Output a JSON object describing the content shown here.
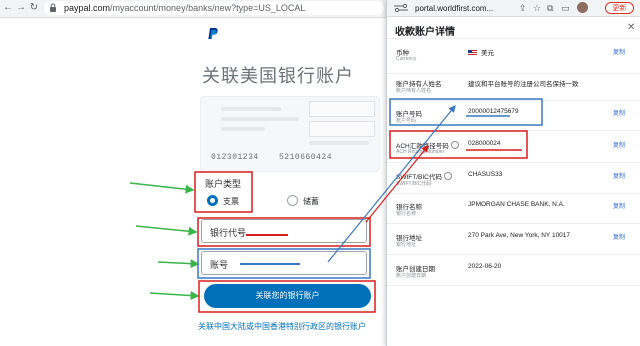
{
  "left_browser": {
    "url_host": "paypal.com",
    "url_path": "/myaccount/money/banks/new?type=US_LOCAL",
    "page_heading": "关联美国银行账户",
    "check_routing_number": "012301234",
    "check_account_number": "5210660424",
    "account_type_label": "账户类型",
    "account_type_options": [
      "支票",
      "储蓄"
    ],
    "account_type_selected": "支票",
    "routing_field_placeholder": "银行代号",
    "account_field_placeholder": "账号",
    "submit_label": "关联您的银行账户",
    "bottom_link": "关联中国大陆或中国香港特别行政区的银行账户"
  },
  "right_browser": {
    "url": "portal.worldfirst.com...",
    "update_label": "更新",
    "panel_title": "收款账户详情",
    "copy_label": "复制",
    "rows": [
      {
        "label": "币种",
        "sub": "Currency",
        "value": "美元",
        "copy": true,
        "flag": "us-flag-icon"
      },
      {
        "label": "账户持有人姓名",
        "sub": "账户持有人姓名",
        "value": "建议和平台账号的注册公司名保持一致",
        "copy": false
      },
      {
        "label": "账户号码",
        "sub": "账户号码",
        "value": "20000012475679",
        "copy": true
      },
      {
        "label": "ACH汇款路径号码",
        "sub": "ACH Routing Number",
        "value": "028000024",
        "copy": true
      },
      {
        "label": "SWIFT/BIC代码",
        "sub": "SWIFT/BIC代码",
        "value": "CHASUS33",
        "copy": true
      },
      {
        "label": "银行名称",
        "sub": "银行名称",
        "value": "JPMORGAN CHASE BANK, N.A.",
        "copy": true
      },
      {
        "label": "银行地址",
        "sub": "银行地址",
        "value": "270 Park Ave, New York, NY 10017",
        "copy": true
      },
      {
        "label": "账户创建日期",
        "sub": "账户创建日期",
        "value": "2022-06-20",
        "copy": false
      }
    ]
  },
  "colors": {
    "paypal_blue": "#0070ba",
    "annotation_red": "#d81e1e",
    "annotation_blue": "#3a78c2",
    "annotation_green": "#39b54a",
    "copy_link": "#2e6bd8"
  }
}
